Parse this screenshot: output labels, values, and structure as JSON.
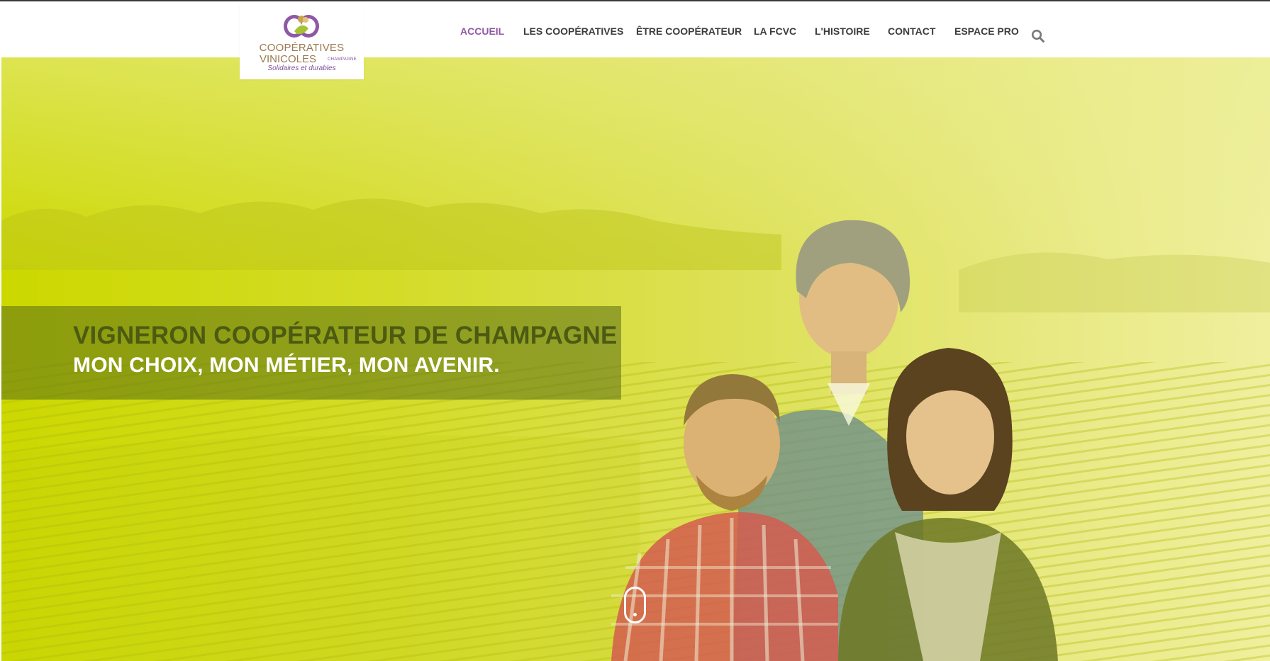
{
  "logo": {
    "line1": "COOPÉRATIVES",
    "line2": "VINICOLES",
    "region": "CHAMPAGNE",
    "tagline": "Solidaires et durables",
    "icon": "cooperatives-logo-icon"
  },
  "nav": {
    "items": [
      {
        "label": "ACCUEIL",
        "active": true
      },
      {
        "label": "LES COOPÉRATIVES",
        "active": false
      },
      {
        "label": "ÊTRE COOPÉRATEUR",
        "active": false
      },
      {
        "label": "LA FCVC",
        "active": false
      },
      {
        "label": "L'HISTOIRE",
        "active": false
      },
      {
        "label": "CONTACT",
        "active": false
      },
      {
        "label": "ESPACE PRO",
        "active": false
      }
    ],
    "search_icon": "search-icon"
  },
  "hero": {
    "title": "VIGNERON COOPÉRATEUR DE CHAMPAGNE",
    "subtitle": "MON CHOIX, MON MÉTIER, MON AVENIR.",
    "scroll_icon": "scroll-down-icon"
  },
  "colors": {
    "accent": "#8f58a6",
    "nav_text": "#3c3c3c",
    "hero_green": "#cbd800",
    "banner_title": "#4c5a12"
  }
}
